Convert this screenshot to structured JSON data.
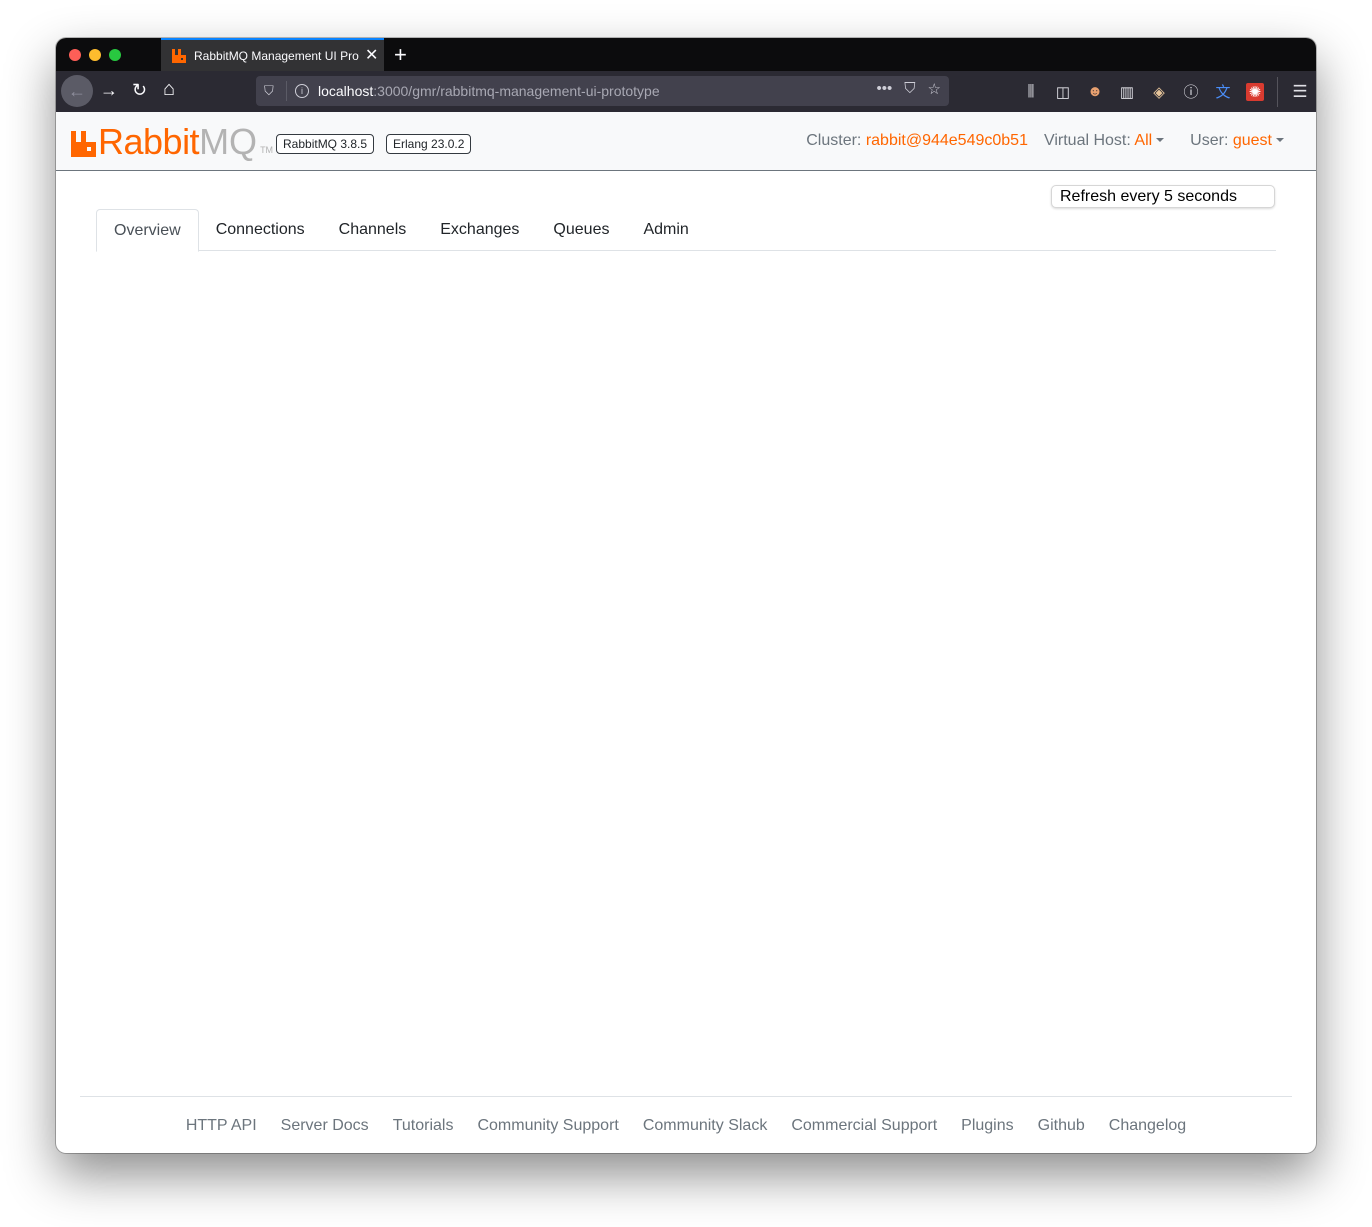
{
  "browser": {
    "tab_title": "RabbitMQ Management UI Prototype",
    "url_host": "localhost",
    "url_path": ":3000/gmr/rabbitmq-management-ui-prototype",
    "new_tab_label": "+",
    "close_tab_label": "✕",
    "back_label": "←",
    "forward_label": "→",
    "reload_label": "↻",
    "home_label": "⌂",
    "page_actions_label": "•••",
    "pocket_label": "⛉",
    "bookmark_label": "☆",
    "toolbar_icons": [
      {
        "name": "library-icon",
        "glyph": "⫼"
      },
      {
        "name": "sidebar-icon",
        "glyph": "◫"
      },
      {
        "name": "profile-extension-icon",
        "glyph": "☻"
      },
      {
        "name": "bookmarks-extension-icon",
        "glyph": "▥"
      },
      {
        "name": "badger-extension-icon",
        "glyph": "◈"
      },
      {
        "name": "onepassword-extension-icon",
        "glyph": "ⓘ"
      },
      {
        "name": "translate-extension-icon",
        "glyph": "文"
      },
      {
        "name": "reddit-extension-icon",
        "glyph": "✺"
      }
    ],
    "menu_label": "☰"
  },
  "header": {
    "logo_rabbit": "Rabbit",
    "logo_mq": "MQ",
    "logo_tm": "TM",
    "rabbitmq_version": "RabbitMQ 3.8.5",
    "erlang_version": "Erlang 23.0.2",
    "cluster_label": "Cluster:",
    "cluster_value": "rabbit@944e549c0b51",
    "vhost_label": "Virtual Host:",
    "vhost_value": "All",
    "user_label": "User:",
    "user_value": "guest",
    "accent_color": "#ff6600"
  },
  "main": {
    "refresh_select": "Refresh every 5 seconds",
    "tabs": [
      {
        "label": "Overview",
        "active": true
      },
      {
        "label": "Connections",
        "active": false
      },
      {
        "label": "Channels",
        "active": false
      },
      {
        "label": "Exchanges",
        "active": false
      },
      {
        "label": "Queues",
        "active": false
      },
      {
        "label": "Admin",
        "active": false
      }
    ]
  },
  "footer": {
    "links": [
      "HTTP API",
      "Server Docs",
      "Tutorials",
      "Community Support",
      "Community Slack",
      "Commercial Support",
      "Plugins",
      "Github",
      "Changelog"
    ]
  }
}
